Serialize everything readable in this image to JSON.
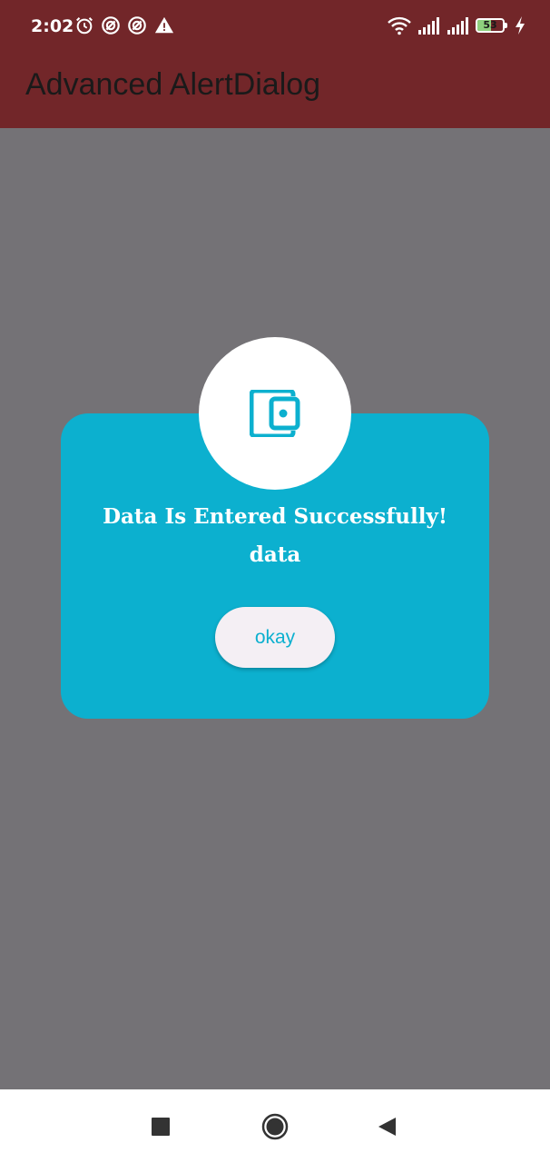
{
  "status_bar": {
    "time": "2:02",
    "battery_level": "53",
    "battery_fraction": 0.53,
    "icons": [
      "alarm-icon",
      "notification-icon",
      "notification-icon",
      "warning-icon",
      "wifi-icon",
      "signal-icon",
      "signal-icon",
      "battery-icon",
      "charging-icon"
    ]
  },
  "app_bar": {
    "title": "Advanced AlertDialog",
    "color": "#722629"
  },
  "dialog": {
    "title": "Data Is Entered Successfully!",
    "message": "data",
    "button_label": "okay",
    "icon": "wallet-icon",
    "accent_color": "#0cb0cf"
  },
  "nav_bar": {
    "buttons": [
      "recents-button",
      "home-button",
      "back-button"
    ]
  }
}
